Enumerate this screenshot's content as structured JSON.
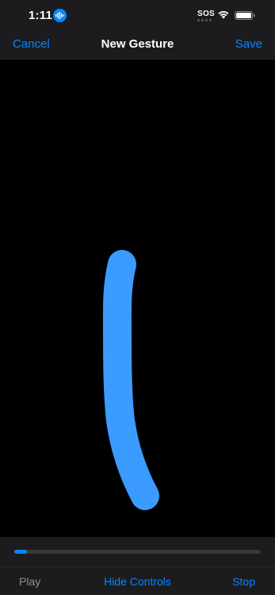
{
  "status_bar": {
    "time": "1:11",
    "sos": "SOS"
  },
  "nav": {
    "cancel_label": "Cancel",
    "title": "New Gesture",
    "save_label": "Save"
  },
  "gesture": {
    "stroke_color": "#3b9bff"
  },
  "playback": {
    "progress": 0.05
  },
  "controls": {
    "play_label": "Play",
    "hide_controls_label": "Hide Controls",
    "stop_label": "Stop"
  },
  "colors": {
    "accent": "#0a84ff",
    "disabled": "#8e8e93",
    "bar_background": "#1c1c1e"
  }
}
